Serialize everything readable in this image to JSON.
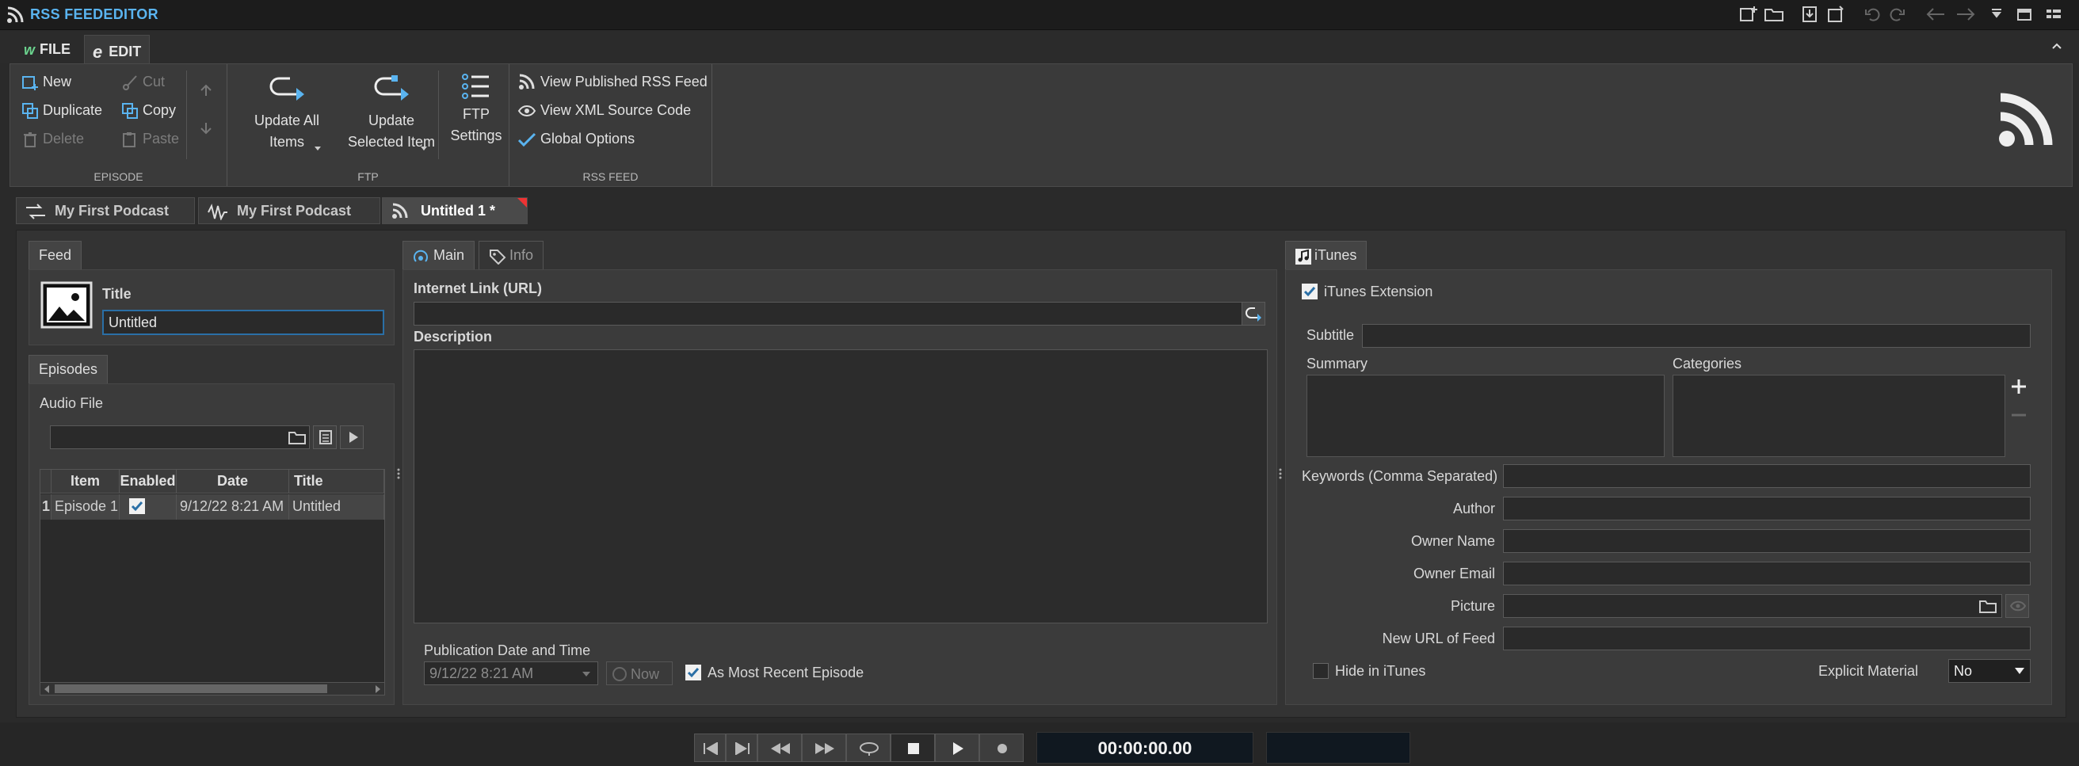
{
  "app": {
    "title": "RSS FEEDEDITOR"
  },
  "ribbon": {
    "tabs": [
      {
        "label": "FILE"
      },
      {
        "label": "EDIT"
      }
    ],
    "episode": {
      "group_label": "EPISODE",
      "new": "New",
      "duplicate": "Duplicate",
      "delete": "Delete",
      "cut": "Cut",
      "copy": "Copy",
      "paste": "Paste"
    },
    "ftp": {
      "group_label": "FTP",
      "update_all_1": "Update All",
      "update_all_2": "Items",
      "update_selected_1": "Update",
      "update_selected_2": "Selected Item",
      "ftp_settings_1": "FTP",
      "ftp_settings_2": "Settings"
    },
    "rss_feed": {
      "group_label": "RSS FEED",
      "view_published": "View Published RSS Feed",
      "view_xml": "View XML Source Code",
      "global_options": "Global Options"
    }
  },
  "doc_tabs": [
    {
      "label": "My First Podcast"
    },
    {
      "label": "My First Podcast"
    },
    {
      "label": "Untitled 1 *"
    }
  ],
  "feed": {
    "tab": "Feed",
    "title_label": "Title",
    "title_value": "Untitled"
  },
  "episodes": {
    "tab": "Episodes",
    "audio_file_label": "Audio File",
    "columns": [
      "Item",
      "Enabled",
      "Date",
      "Title"
    ],
    "rows": [
      {
        "num": "1",
        "item": "Episode 1",
        "enabled": true,
        "date": "9/12/22 8:21 AM",
        "title": "Untitled"
      }
    ]
  },
  "main": {
    "tabs": [
      {
        "label": "Main"
      },
      {
        "label": "Info"
      }
    ],
    "url_label": "Internet Link (URL)",
    "description_label": "Description",
    "pub_label": "Publication Date and Time",
    "pub_value": "9/12/22 8:21 AM",
    "now_label": "Now",
    "most_recent_label": "As Most Recent Episode",
    "most_recent_checked": true
  },
  "itunes": {
    "tab": "iTunes",
    "extension_label": "iTunes Extension",
    "extension_checked": true,
    "subtitle_label": "Subtitle",
    "summary_label": "Summary",
    "categories_label": "Categories",
    "keywords_label": "Keywords (Comma Separated)",
    "author_label": "Author",
    "owner_name_label": "Owner Name",
    "owner_email_label": "Owner Email",
    "picture_label": "Picture",
    "new_url_label": "New URL of Feed",
    "hide_label": "Hide in iTunes",
    "hide_checked": false,
    "explicit_label": "Explicit Material",
    "explicit_value": "No"
  },
  "transport": {
    "time": "00:00:00.00"
  },
  "colors": {
    "accent": "#5ab4f0",
    "background": "#2a2a2a",
    "panel": "#3b3b3b"
  }
}
